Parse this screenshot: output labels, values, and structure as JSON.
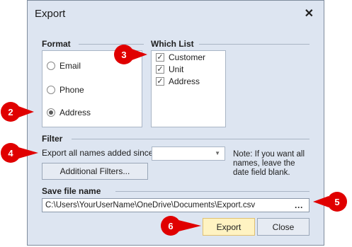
{
  "dialog": {
    "title": "Export",
    "close_glyph": "✕"
  },
  "format": {
    "heading": "Format",
    "options": [
      {
        "label": "Email",
        "selected": false
      },
      {
        "label": "Phone",
        "selected": false
      },
      {
        "label": "Address",
        "selected": true
      }
    ]
  },
  "which_list": {
    "heading": "Which List",
    "items": [
      {
        "label": "Customer",
        "checked": true
      },
      {
        "label": "Unit",
        "checked": true
      },
      {
        "label": "Address",
        "checked": true
      }
    ],
    "check_glyph": "✓"
  },
  "filter": {
    "heading": "Filter",
    "since_label": "Export all names added since",
    "date_value": "",
    "note": [
      "Note: If you want all",
      "names, leave the",
      "date field blank."
    ],
    "additional_filters_label": "Additional Filters..."
  },
  "save_file": {
    "heading": "Save file name",
    "path": "C:\\Users\\YourUserName\\OneDrive\\Documents\\Export.csv",
    "browse_glyph": "···"
  },
  "actions": {
    "export_label": "Export",
    "close_label": "Close"
  },
  "callouts": [
    "2",
    "3",
    "4",
    "5",
    "6"
  ],
  "colors": {
    "callout_red": "#e00000",
    "dialog_bg": "#dde5f1",
    "export_bg": "#fff3c2"
  }
}
